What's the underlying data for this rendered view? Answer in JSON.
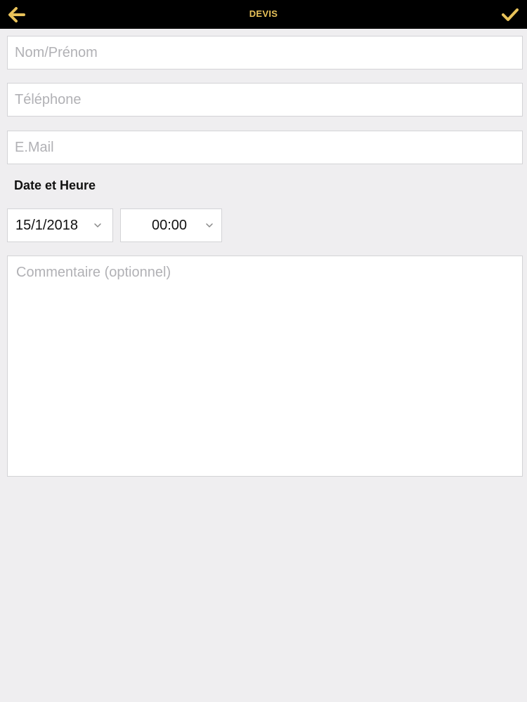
{
  "colors": {
    "accent": "#e8c25a",
    "navbar_bg": "#000000",
    "background": "#efeef0"
  },
  "header": {
    "title": "DEVIS",
    "back_icon": "arrow-left-icon",
    "confirm_icon": "checkmark-icon"
  },
  "form": {
    "name_placeholder": "Nom/Prénom",
    "phone_placeholder": "Téléphone",
    "email_placeholder": "E.Mail",
    "datetime_label": "Date et Heure",
    "date_value": "15/1/2018",
    "time_value": "00:00",
    "comment_placeholder": "Commentaire (optionnel)"
  }
}
